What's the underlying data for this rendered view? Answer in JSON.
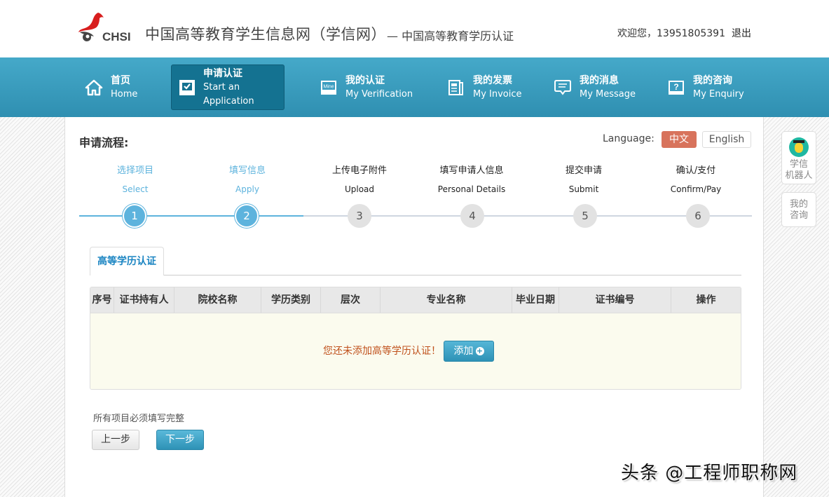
{
  "header": {
    "logo_text": "CHSI",
    "site_title": "中国高等教育学生信息网（学信网）",
    "site_subtitle": "— 中国高等教育学历认证",
    "welcome": "欢迎您，13951805391",
    "logout": "退出"
  },
  "nav": {
    "items": [
      {
        "cn": "首页",
        "en": "Home",
        "icon": "home-icon",
        "active": false
      },
      {
        "cn": "申请认证",
        "en": "Start an Application",
        "icon": "checkbox-icon",
        "active": true
      },
      {
        "cn": "我的认证",
        "en": "My Verification",
        "icon": "mine-icon",
        "active": false
      },
      {
        "cn": "我的发票",
        "en": "My Invoice",
        "icon": "invoice-icon",
        "active": false
      },
      {
        "cn": "我的消息",
        "en": "My Message",
        "icon": "message-icon",
        "active": false
      },
      {
        "cn": "我的咨询",
        "en": "My Enquiry",
        "icon": "question-icon",
        "active": false
      }
    ]
  },
  "process": {
    "title": "申请流程:",
    "language_label": "Language:",
    "lang_cn": "中文",
    "lang_en": "English",
    "current_step": 2,
    "steps": [
      {
        "num": "1",
        "cn": "选择项目",
        "en": "Select",
        "status": "done"
      },
      {
        "num": "2",
        "cn": "填写信息",
        "en": "Apply",
        "status": "done"
      },
      {
        "num": "3",
        "cn": "上传电子附件",
        "en": "Upload",
        "status": "todo"
      },
      {
        "num": "4",
        "cn": "填写申请人信息",
        "en": "Personal Details",
        "status": "todo"
      },
      {
        "num": "5",
        "cn": "提交申请",
        "en": "Submit",
        "status": "todo"
      },
      {
        "num": "6",
        "cn": "确认/支付",
        "en": "Confirm/Pay",
        "status": "todo"
      }
    ]
  },
  "tab": {
    "label": "高等学历认证"
  },
  "table": {
    "columns": [
      "序号",
      "证书持有人",
      "院校名称",
      "学历类别",
      "层次",
      "专业名称",
      "毕业日期",
      "证书编号",
      "操作"
    ],
    "rows": [],
    "empty_message": "您还未添加高等学历认证！",
    "add_button": "添加"
  },
  "footer_form": {
    "note": "所有项目必须填写完整",
    "prev": "上一步",
    "next": "下一步"
  },
  "side": {
    "robot_label_1": "学信",
    "robot_label_2": "机器人",
    "enquiry_label_1": "我的",
    "enquiry_label_2": "咨询"
  },
  "watermark": "头条 @工程师职称网",
  "colors": {
    "nav_bg": "#3a9dc0",
    "nav_active": "#147291",
    "step_done": "#5db3dd",
    "lang_active": "#d8735c",
    "empty_text": "#c0511c",
    "tab_text": "#1a84c2"
  }
}
